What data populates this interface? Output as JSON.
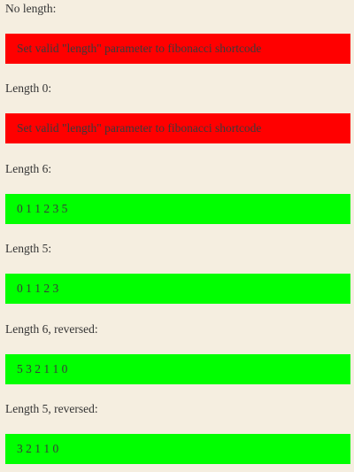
{
  "sections": [
    {
      "label": "No length:",
      "output": "Set valid \"length\" parameter to fibonacci shortcode",
      "status": "error"
    },
    {
      "label": "Length 0:",
      "output": "Set valid \"length\" parameter to fibonacci shortcode",
      "status": "error"
    },
    {
      "label": "Length 6:",
      "output": "0 1 1 2 3 5",
      "status": "ok"
    },
    {
      "label": "Length 5:",
      "output": "0 1 1 2 3",
      "status": "ok"
    },
    {
      "label": "Length 6, reversed:",
      "output": "5 3 2 1 1 0",
      "status": "ok"
    },
    {
      "label": "Length 5, reversed:",
      "output": "3 2 1 1 0",
      "status": "ok"
    }
  ],
  "colors": {
    "background": "#f5eee0",
    "error": "#ff0000",
    "ok": "#00ff00",
    "text": "#333333"
  }
}
